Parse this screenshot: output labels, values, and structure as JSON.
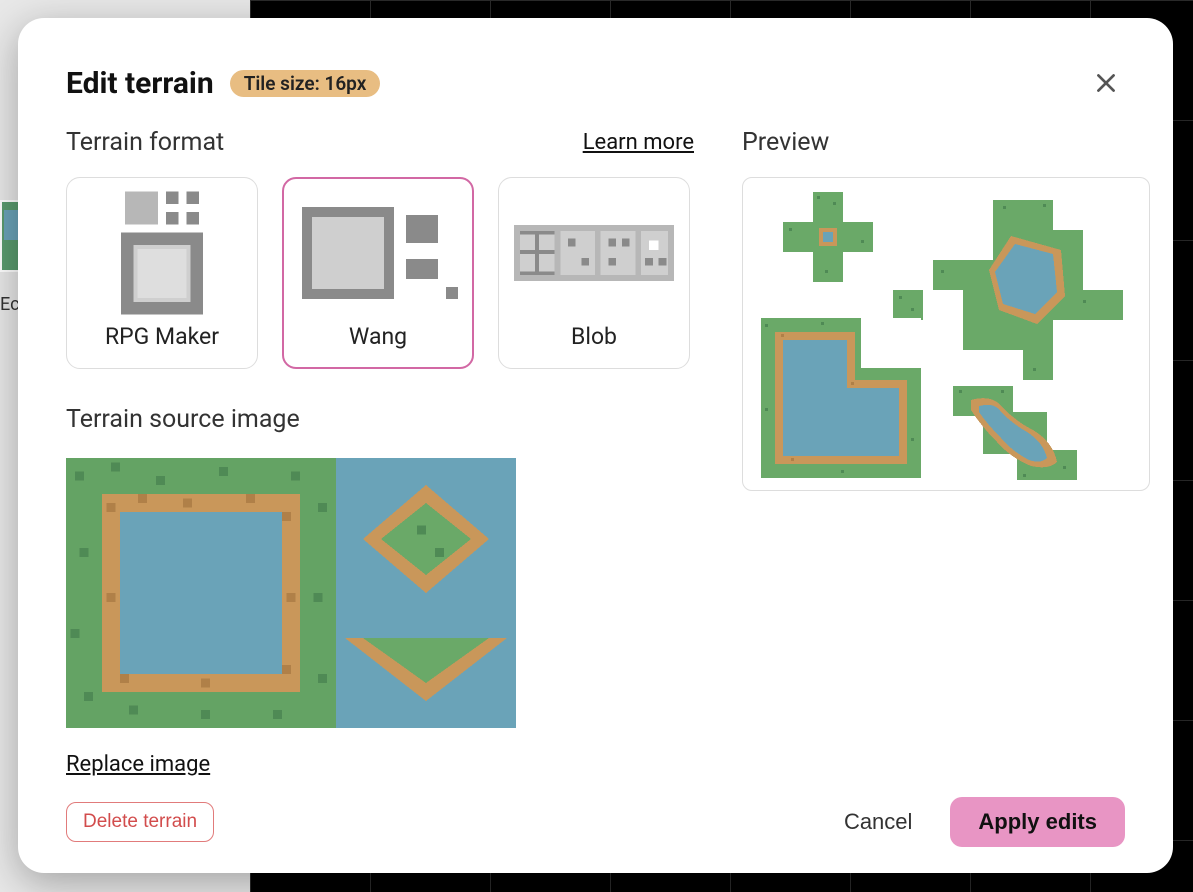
{
  "dialog": {
    "title": "Edit terrain",
    "badge": "Tile size: 16px",
    "close_icon": "close"
  },
  "sections": {
    "format_title": "Terrain format",
    "learn_more": "Learn more",
    "source_title": "Terrain source image",
    "replace_image": "Replace image",
    "preview_title": "Preview"
  },
  "format_options": [
    {
      "id": "rpg-maker",
      "label": "RPG Maker",
      "selected": false
    },
    {
      "id": "wang",
      "label": "Wang",
      "selected": true
    },
    {
      "id": "blob",
      "label": "Blob",
      "selected": false
    }
  ],
  "footer": {
    "delete": "Delete terrain",
    "cancel": "Cancel",
    "apply": "Apply edits"
  },
  "background": {
    "sidebar_label": "Ec"
  },
  "colors": {
    "accent": "#d268a4",
    "badge_bg": "#e8bd82",
    "grass": "#6aa968",
    "grass_dark": "#4f8a55",
    "water": "#6aa3b8",
    "sand": "#c9975a"
  }
}
